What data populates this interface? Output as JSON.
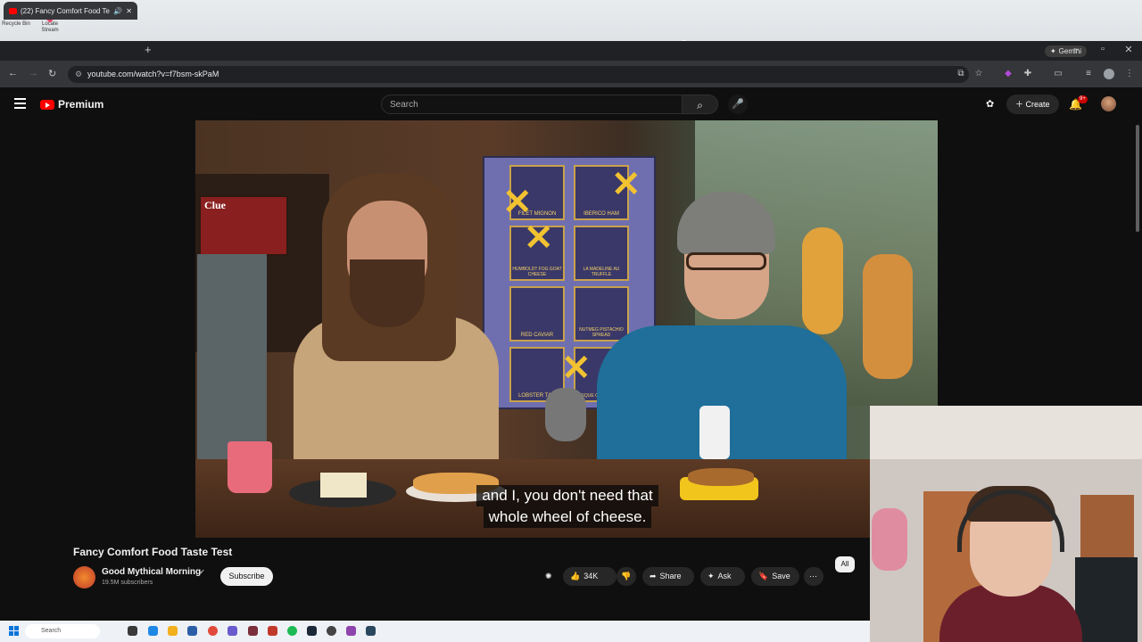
{
  "desktop": {
    "icons": [
      {
        "label": "Recycle Bin",
        "icon": "recycle-bin-icon"
      },
      {
        "label": "Locate Stream",
        "icon": "map-pin-icon"
      }
    ]
  },
  "browser": {
    "tab_title": "(22) Fancy Comfort Food Te",
    "url": "youtube.com/watch?v=f7bsm-skPaM",
    "gemini_label": "Gemini"
  },
  "youtube": {
    "logo_text": "Premium",
    "search_placeholder": "Search",
    "create_label": "Create",
    "notification_count": "9+"
  },
  "video": {
    "caption_line1": "and I, you don't need that",
    "caption_line2": "whole wheel of cheese.",
    "board_items": [
      "FILET MIGNON",
      "IBERICO HAM",
      "HUMBOLDT FOG GOAT CHEESE",
      "LA MADELINE AU TRUFFLE",
      "RED CAVIAR",
      "NUTMEG PISTACHIO SPREAD",
      "LOBSTER TAIL",
      "BISQUE CHEESECAKE"
    ],
    "clue_sign": "Clue"
  },
  "meta": {
    "title": "Fancy Comfort Food Taste Test",
    "channel": "Good Mythical Morning",
    "subscribers": "19.5M subscribers",
    "subscribe_label": "Subscribe",
    "like_count": "34K",
    "share_label": "Share",
    "ask_label": "Ask",
    "save_label": "Save",
    "chip_all": "All"
  },
  "taskbar": {
    "search_placeholder": "Search"
  }
}
